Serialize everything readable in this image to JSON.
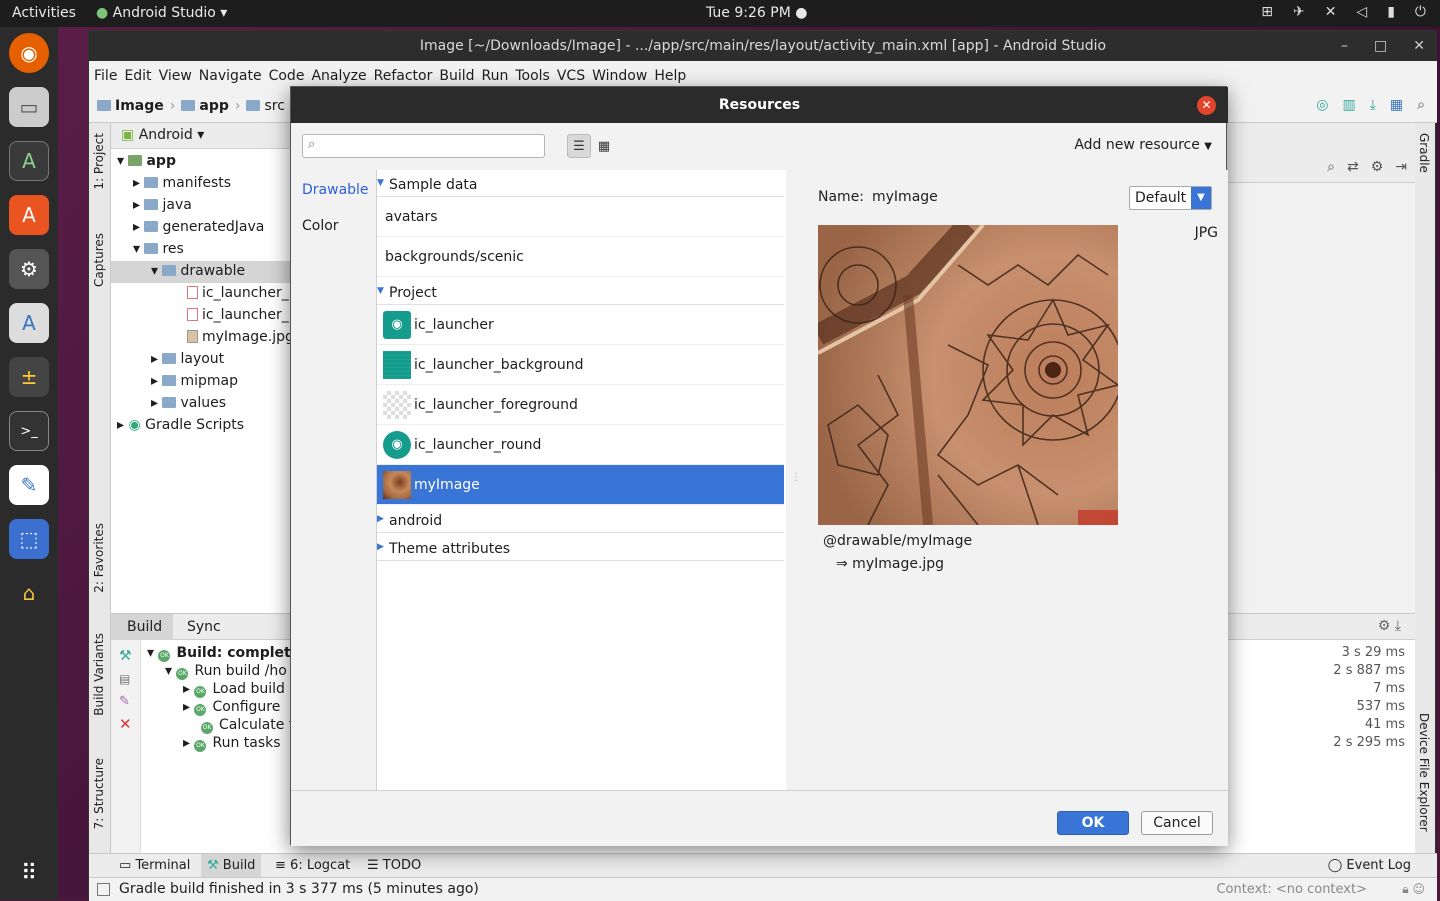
{
  "topbar": {
    "activities": "Activities",
    "app": "Android Studio",
    "clock": "Tue  9:26 PM"
  },
  "window": {
    "title": "Image [~/Downloads/Image] - .../app/src/main/res/layout/activity_main.xml [app] - Android Studio"
  },
  "menu": [
    "File",
    "Edit",
    "View",
    "Navigate",
    "Code",
    "Analyze",
    "Refactor",
    "Build",
    "Run",
    "Tools",
    "VCS",
    "Window",
    "Help"
  ],
  "breadcrumb": [
    "Image",
    "app",
    "src"
  ],
  "side_tabs": {
    "project": "1: Project",
    "captures": "Captures",
    "favorites": "2: Favorites",
    "build_variants": "Build Variants",
    "structure": "7: Structure",
    "gradle": "Gradle",
    "device_explorer": "Device File Explorer"
  },
  "project": {
    "view": "Android",
    "tree": [
      "app",
      "manifests",
      "java",
      "generatedJava",
      "res",
      "drawable",
      "ic_launcher_",
      "ic_launcher_",
      "myImage.jpg",
      "layout",
      "mipmap",
      "values",
      "Gradle Scripts"
    ]
  },
  "build": {
    "tabs": [
      "Build",
      "Sync"
    ],
    "rows": [
      "Build: complete",
      "Run build /ho",
      "Load build",
      "Configure",
      "Calculate t",
      "Run tasks"
    ],
    "times": [
      "3 s 29 ms",
      "2 s 887 ms",
      "7 ms",
      "537 ms",
      "41 ms",
      "2 s 295 ms"
    ]
  },
  "bottom_tabs": {
    "terminal": "Terminal",
    "build": "Build",
    "logcat": "6: Logcat",
    "todo": "TODO",
    "event_log": "Event Log"
  },
  "status": {
    "message": "Gradle build finished in 3 s 377 ms (5 minutes ago)",
    "context": "Context: <no context>"
  },
  "dialog": {
    "title": "Resources",
    "add_new": "Add new resource",
    "categories": [
      "Drawable",
      "Color"
    ],
    "sections": {
      "sample": "Sample data",
      "project": "Project",
      "android": "android",
      "theme": "Theme attributes"
    },
    "sample_items": [
      "avatars",
      "backgrounds/scenic"
    ],
    "project_items": [
      "ic_launcher",
      "ic_launcher_background",
      "ic_launcher_foreground",
      "ic_launcher_round",
      "myImage"
    ],
    "preview": {
      "name_label": "Name:",
      "name": "myImage",
      "density": "Default",
      "type": "JPG",
      "reference": "@drawable/myImage",
      "file": "⇒ myImage.jpg"
    },
    "ok": "OK",
    "cancel": "Cancel"
  }
}
